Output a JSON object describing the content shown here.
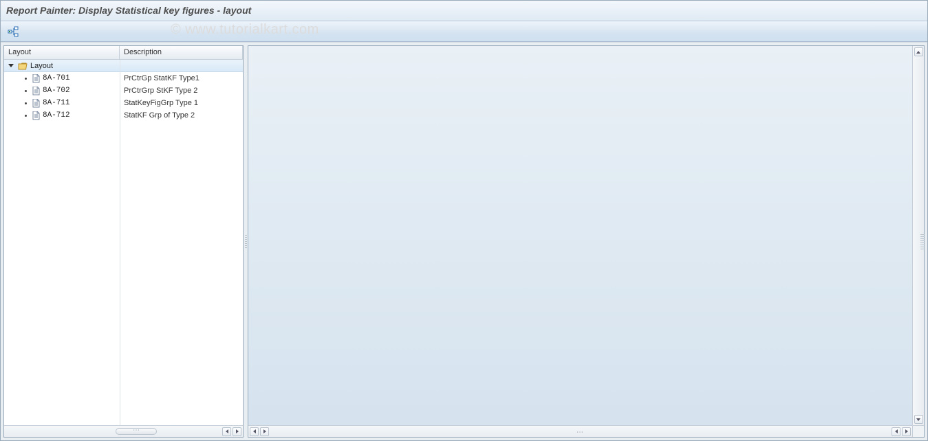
{
  "window": {
    "title": "Report Painter: Display Statistical key figures - layout"
  },
  "toolbar": {
    "expand_icon_name": "expand-hierarchy-icon"
  },
  "tree": {
    "headers": {
      "layout": "Layout",
      "description": "Description"
    },
    "root": {
      "label": "Layout"
    },
    "items": [
      {
        "code": "8A-701",
        "desc": "PrCtrGp StatKF Type1"
      },
      {
        "code": "8A-702",
        "desc": "PrCtrGrp StKF Type 2"
      },
      {
        "code": "8A-711",
        "desc": "StatKeyFigGrp Type 1"
      },
      {
        "code": "8A-712",
        "desc": "StatKF Grp of Type 2"
      }
    ]
  },
  "watermark": "© www.tutorialkart.com"
}
